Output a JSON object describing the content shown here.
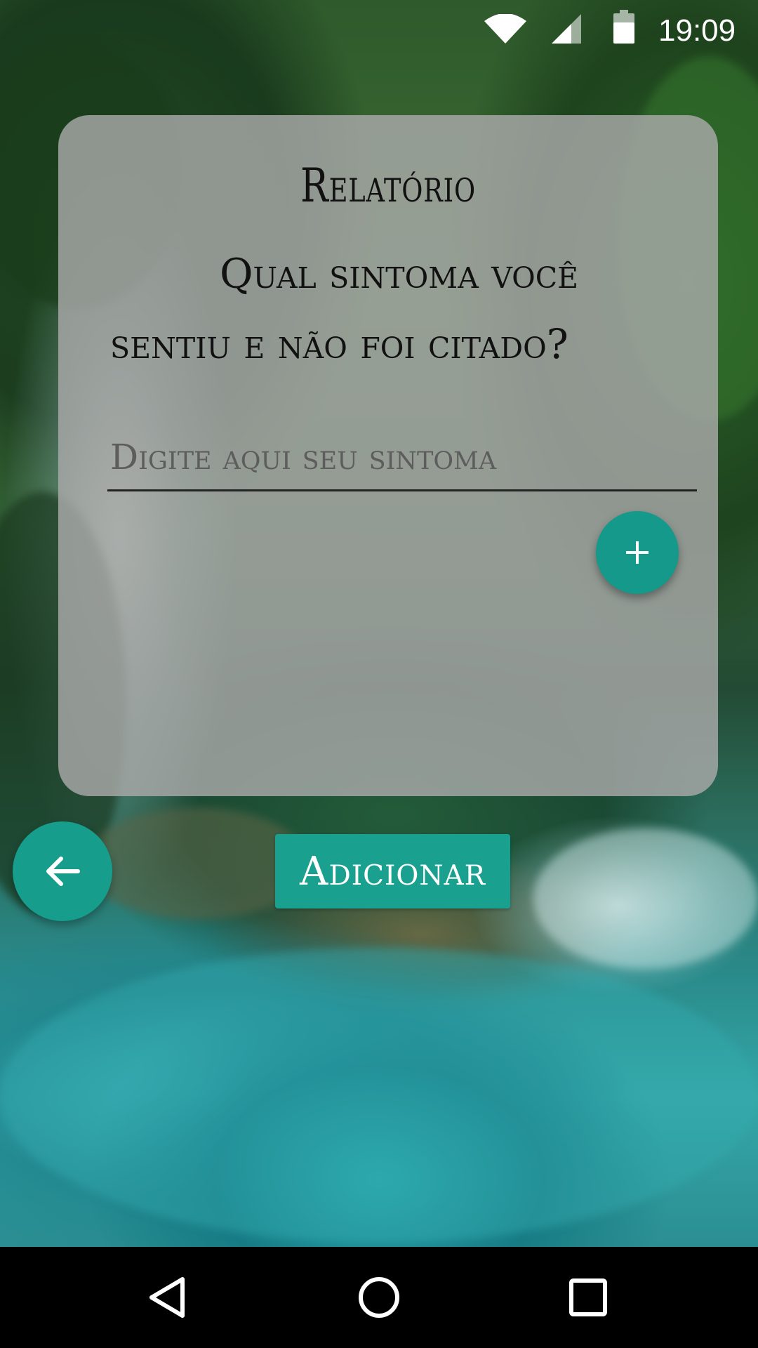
{
  "status_bar": {
    "time": "19:09",
    "icons": [
      "wifi-icon",
      "cell-signal-icon",
      "battery-icon"
    ]
  },
  "card": {
    "title": "Relatório",
    "question": "Qual sintoma  você sentiu e não foi citado?",
    "input": {
      "value": "",
      "placeholder": "Digite aqui seu sintoma"
    },
    "add_fab_icon": "plus-icon"
  },
  "buttons": {
    "back_icon": "arrow-left-icon",
    "add_label": "Adicionar"
  },
  "nav_bar": {
    "items": [
      "back-triangle-icon",
      "home-circle-icon",
      "recents-square-icon"
    ]
  },
  "colors": {
    "accent": "#15998a",
    "card_bg": "#aaaaaa",
    "nav_bg": "#000000"
  }
}
